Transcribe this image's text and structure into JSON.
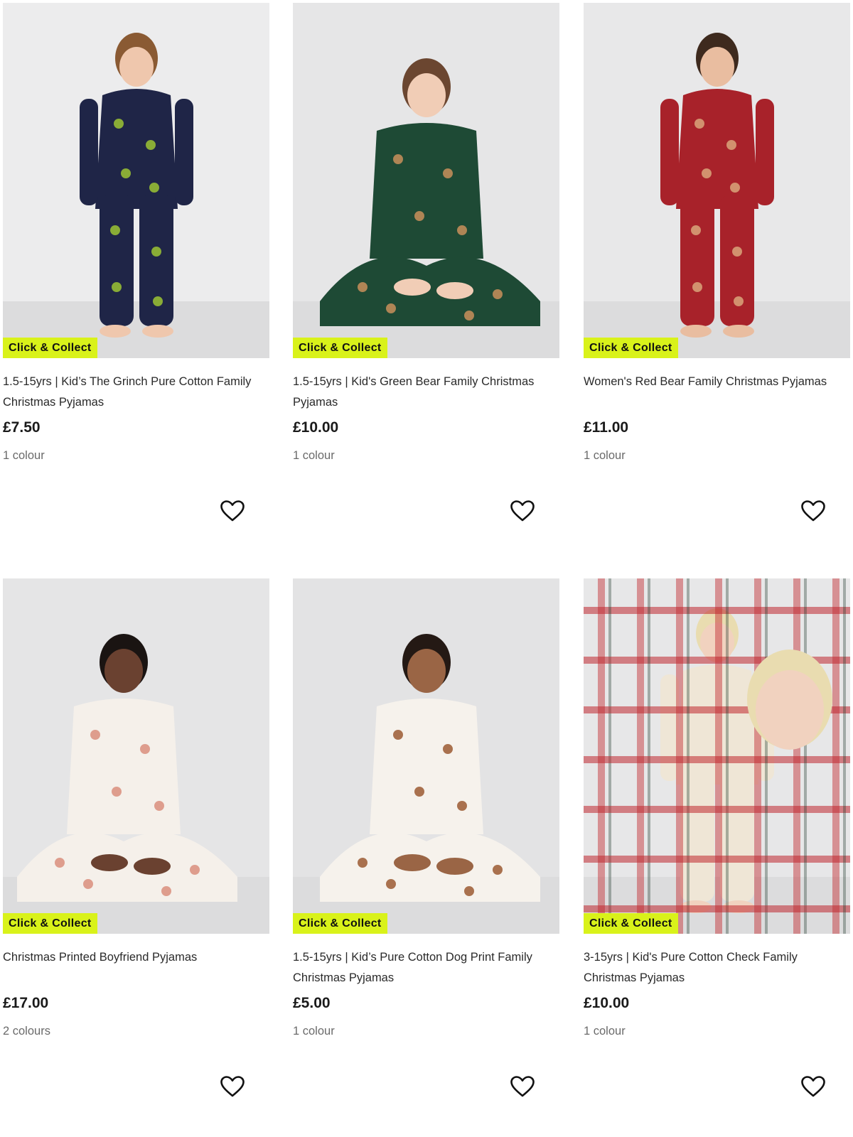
{
  "badge_color": "#d9f21a",
  "products": [
    {
      "badge": "Click & Collect",
      "title": "1.5-15yrs | Kid’s The Grinch Pure Cotton Family Christmas Pyjamas",
      "price": "£7.50",
      "colours": "1 colour",
      "wishlist_icon": "heart-outline-icon",
      "palette": {
        "bg": "#ececed",
        "top": "#1f2547",
        "bottom": "#1f2547",
        "accent": "#9cc434",
        "skin": "#efc7ad",
        "hair": "#8a5a33"
      }
    },
    {
      "badge": "Click & Collect",
      "title": "1.5-15yrs | Kid's Green Bear Family Christmas Pyjamas",
      "price": "£10.00",
      "colours": "1 colour",
      "wishlist_icon": "heart-outline-icon",
      "palette": {
        "bg": "#e6e6e7",
        "top": "#1e4a35",
        "bottom": "#1e4a35",
        "accent": "#c98f5a",
        "skin": "#f1cdb6",
        "hair": "#6b4630"
      }
    },
    {
      "badge": "Click & Collect",
      "title": "Women's Red Bear Family Christmas Pyjamas",
      "price": "£11.00",
      "colours": "1 colour",
      "wishlist_icon": "heart-outline-icon",
      "palette": {
        "bg": "#e8e8e9",
        "top": "#a8222a",
        "bottom": "#a8222a",
        "accent": "#d9a57a",
        "skin": "#e9bda0",
        "hair": "#3e2a1e"
      }
    },
    {
      "badge": "Click & Collect",
      "title": "Christmas Printed Boyfriend Pyjamas",
      "price": "£17.00",
      "colours": "2 colours",
      "wishlist_icon": "heart-outline-icon",
      "palette": {
        "bg": "#e5e5e6",
        "top": "#f5f0ea",
        "bottom": "#f5f0ea",
        "accent": "#d98e7c",
        "skin": "#6a4130",
        "hair": "#1a1412"
      }
    },
    {
      "badge": "Click & Collect",
      "title": "1.5-15yrs | Kid’s Pure Cotton Dog Print Family Christmas Pyjamas",
      "price": "£5.00",
      "colours": "1 colour",
      "wishlist_icon": "heart-outline-icon",
      "palette": {
        "bg": "#e3e3e4",
        "top": "#f6f2ec",
        "bottom": "#f6f2ec",
        "accent": "#9b5a32",
        "skin": "#9a6545",
        "hair": "#241914"
      }
    },
    {
      "badge": "Click & Collect",
      "title": "3-15yrs | Kid's Pure Cotton Check Family Christmas Pyjamas",
      "price": "£10.00",
      "colours": "1 colour",
      "wishlist_icon": "heart-outline-icon",
      "palette": {
        "bg": "#e7e7e8",
        "top": "#efe6d6",
        "bottom": "#efe6d6",
        "accent": "#c0262d",
        "skin": "#f1d2bf",
        "hair": "#e9dcb0"
      }
    }
  ]
}
